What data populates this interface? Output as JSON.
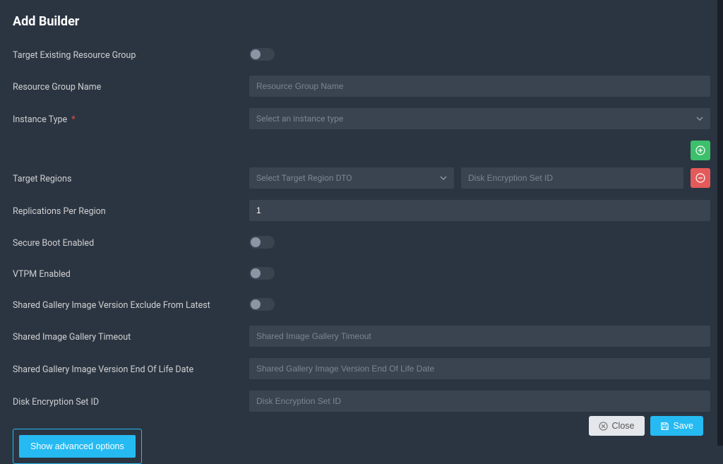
{
  "title": "Add Builder",
  "labels": {
    "target_existing_rg": "Target Existing Resource Group",
    "rg_name": "Resource Group Name",
    "instance_type": "Instance Type",
    "target_regions": "Target Regions",
    "replications": "Replications Per Region",
    "secure_boot": "Secure Boot Enabled",
    "vtpm": "VTPM Enabled",
    "exclude_latest": "Shared Gallery Image Version Exclude From Latest",
    "gallery_timeout": "Shared Image Gallery Timeout",
    "eol_date": "Shared Gallery Image Version End Of Life Date",
    "disk_encryption": "Disk Encryption Set ID"
  },
  "placeholders": {
    "rg_name": "Resource Group Name",
    "instance_type": "Select an instance type",
    "target_region_dto": "Select Target Region DTO",
    "disk_encryption_small": "Disk Encryption Set ID",
    "gallery_timeout": "Shared Image Gallery Timeout",
    "eol_date": "Shared Gallery Image Version End Of Life Date",
    "disk_encryption": "Disk Encryption Set ID"
  },
  "values": {
    "replications": "1"
  },
  "buttons": {
    "advanced": "Show advanced options",
    "close": "Close",
    "save": "Save"
  },
  "required_marker": "*"
}
